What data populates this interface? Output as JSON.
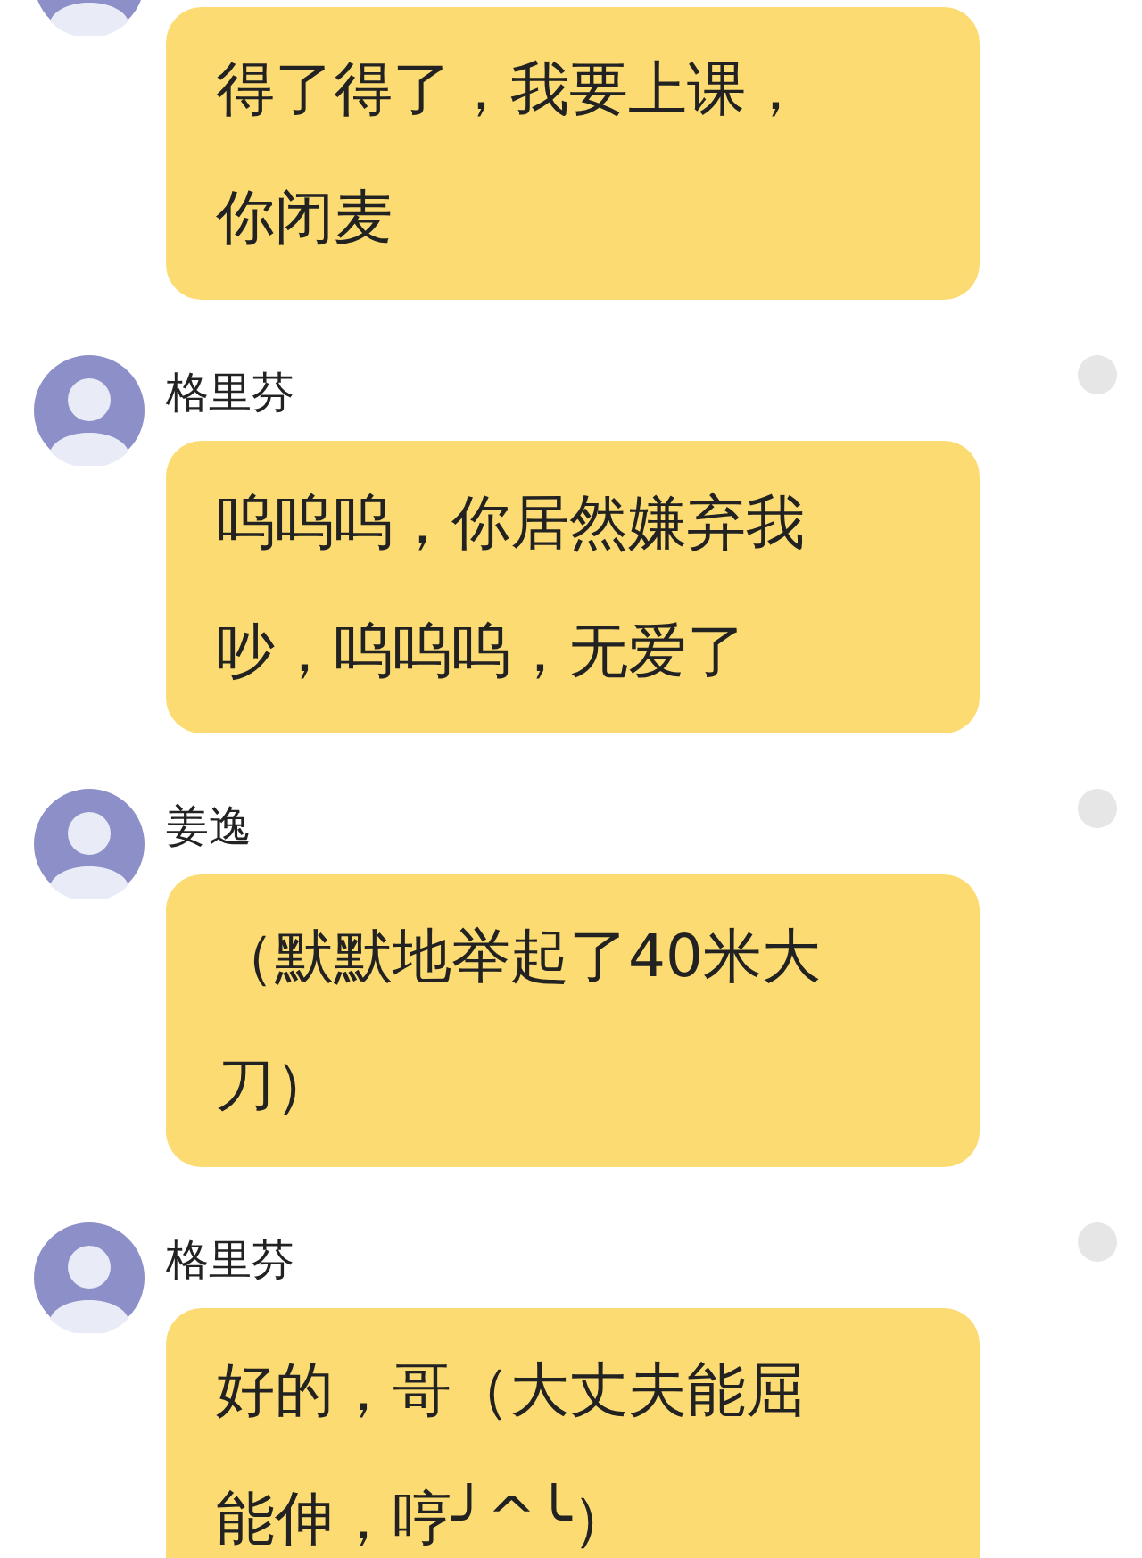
{
  "messages": [
    {
      "lines": [
        "得了得了，我要上课，",
        "你闭麦"
      ]
    },
    {
      "sender": "格里芬",
      "lines": [
        "呜呜呜，你居然嫌弃我",
        "吵，呜呜呜，无爱了"
      ]
    },
    {
      "sender": "姜逸",
      "lines": [
        "（默默地举起了40米大",
        "刀）"
      ]
    },
    {
      "sender": "格里芬",
      "lines": [
        "好的，哥（大丈夫能屈",
        "能伸，哼╯^╰）"
      ]
    }
  ]
}
